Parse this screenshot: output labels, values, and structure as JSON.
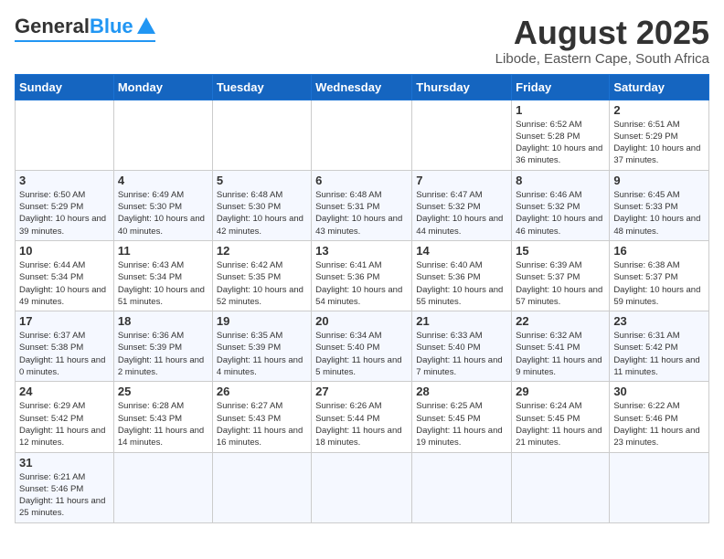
{
  "header": {
    "logo_general": "General",
    "logo_blue": "Blue",
    "title": "August 2025",
    "subtitle": "Libode, Eastern Cape, South Africa"
  },
  "days_of_week": [
    "Sunday",
    "Monday",
    "Tuesday",
    "Wednesday",
    "Thursday",
    "Friday",
    "Saturday"
  ],
  "weeks": [
    [
      {
        "day": "",
        "info": ""
      },
      {
        "day": "",
        "info": ""
      },
      {
        "day": "",
        "info": ""
      },
      {
        "day": "",
        "info": ""
      },
      {
        "day": "",
        "info": ""
      },
      {
        "day": "1",
        "info": "Sunrise: 6:52 AM\nSunset: 5:28 PM\nDaylight: 10 hours and 36 minutes."
      },
      {
        "day": "2",
        "info": "Sunrise: 6:51 AM\nSunset: 5:29 PM\nDaylight: 10 hours and 37 minutes."
      }
    ],
    [
      {
        "day": "3",
        "info": "Sunrise: 6:50 AM\nSunset: 5:29 PM\nDaylight: 10 hours and 39 minutes."
      },
      {
        "day": "4",
        "info": "Sunrise: 6:49 AM\nSunset: 5:30 PM\nDaylight: 10 hours and 40 minutes."
      },
      {
        "day": "5",
        "info": "Sunrise: 6:48 AM\nSunset: 5:30 PM\nDaylight: 10 hours and 42 minutes."
      },
      {
        "day": "6",
        "info": "Sunrise: 6:48 AM\nSunset: 5:31 PM\nDaylight: 10 hours and 43 minutes."
      },
      {
        "day": "7",
        "info": "Sunrise: 6:47 AM\nSunset: 5:32 PM\nDaylight: 10 hours and 44 minutes."
      },
      {
        "day": "8",
        "info": "Sunrise: 6:46 AM\nSunset: 5:32 PM\nDaylight: 10 hours and 46 minutes."
      },
      {
        "day": "9",
        "info": "Sunrise: 6:45 AM\nSunset: 5:33 PM\nDaylight: 10 hours and 48 minutes."
      }
    ],
    [
      {
        "day": "10",
        "info": "Sunrise: 6:44 AM\nSunset: 5:34 PM\nDaylight: 10 hours and 49 minutes."
      },
      {
        "day": "11",
        "info": "Sunrise: 6:43 AM\nSunset: 5:34 PM\nDaylight: 10 hours and 51 minutes."
      },
      {
        "day": "12",
        "info": "Sunrise: 6:42 AM\nSunset: 5:35 PM\nDaylight: 10 hours and 52 minutes."
      },
      {
        "day": "13",
        "info": "Sunrise: 6:41 AM\nSunset: 5:36 PM\nDaylight: 10 hours and 54 minutes."
      },
      {
        "day": "14",
        "info": "Sunrise: 6:40 AM\nSunset: 5:36 PM\nDaylight: 10 hours and 55 minutes."
      },
      {
        "day": "15",
        "info": "Sunrise: 6:39 AM\nSunset: 5:37 PM\nDaylight: 10 hours and 57 minutes."
      },
      {
        "day": "16",
        "info": "Sunrise: 6:38 AM\nSunset: 5:37 PM\nDaylight: 10 hours and 59 minutes."
      }
    ],
    [
      {
        "day": "17",
        "info": "Sunrise: 6:37 AM\nSunset: 5:38 PM\nDaylight: 11 hours and 0 minutes."
      },
      {
        "day": "18",
        "info": "Sunrise: 6:36 AM\nSunset: 5:39 PM\nDaylight: 11 hours and 2 minutes."
      },
      {
        "day": "19",
        "info": "Sunrise: 6:35 AM\nSunset: 5:39 PM\nDaylight: 11 hours and 4 minutes."
      },
      {
        "day": "20",
        "info": "Sunrise: 6:34 AM\nSunset: 5:40 PM\nDaylight: 11 hours and 5 minutes."
      },
      {
        "day": "21",
        "info": "Sunrise: 6:33 AM\nSunset: 5:40 PM\nDaylight: 11 hours and 7 minutes."
      },
      {
        "day": "22",
        "info": "Sunrise: 6:32 AM\nSunset: 5:41 PM\nDaylight: 11 hours and 9 minutes."
      },
      {
        "day": "23",
        "info": "Sunrise: 6:31 AM\nSunset: 5:42 PM\nDaylight: 11 hours and 11 minutes."
      }
    ],
    [
      {
        "day": "24",
        "info": "Sunrise: 6:29 AM\nSunset: 5:42 PM\nDaylight: 11 hours and 12 minutes."
      },
      {
        "day": "25",
        "info": "Sunrise: 6:28 AM\nSunset: 5:43 PM\nDaylight: 11 hours and 14 minutes."
      },
      {
        "day": "26",
        "info": "Sunrise: 6:27 AM\nSunset: 5:43 PM\nDaylight: 11 hours and 16 minutes."
      },
      {
        "day": "27",
        "info": "Sunrise: 6:26 AM\nSunset: 5:44 PM\nDaylight: 11 hours and 18 minutes."
      },
      {
        "day": "28",
        "info": "Sunrise: 6:25 AM\nSunset: 5:45 PM\nDaylight: 11 hours and 19 minutes."
      },
      {
        "day": "29",
        "info": "Sunrise: 6:24 AM\nSunset: 5:45 PM\nDaylight: 11 hours and 21 minutes."
      },
      {
        "day": "30",
        "info": "Sunrise: 6:22 AM\nSunset: 5:46 PM\nDaylight: 11 hours and 23 minutes."
      }
    ],
    [
      {
        "day": "31",
        "info": "Sunrise: 6:21 AM\nSunset: 5:46 PM\nDaylight: 11 hours and 25 minutes."
      },
      {
        "day": "",
        "info": ""
      },
      {
        "day": "",
        "info": ""
      },
      {
        "day": "",
        "info": ""
      },
      {
        "day": "",
        "info": ""
      },
      {
        "day": "",
        "info": ""
      },
      {
        "day": "",
        "info": ""
      }
    ]
  ]
}
